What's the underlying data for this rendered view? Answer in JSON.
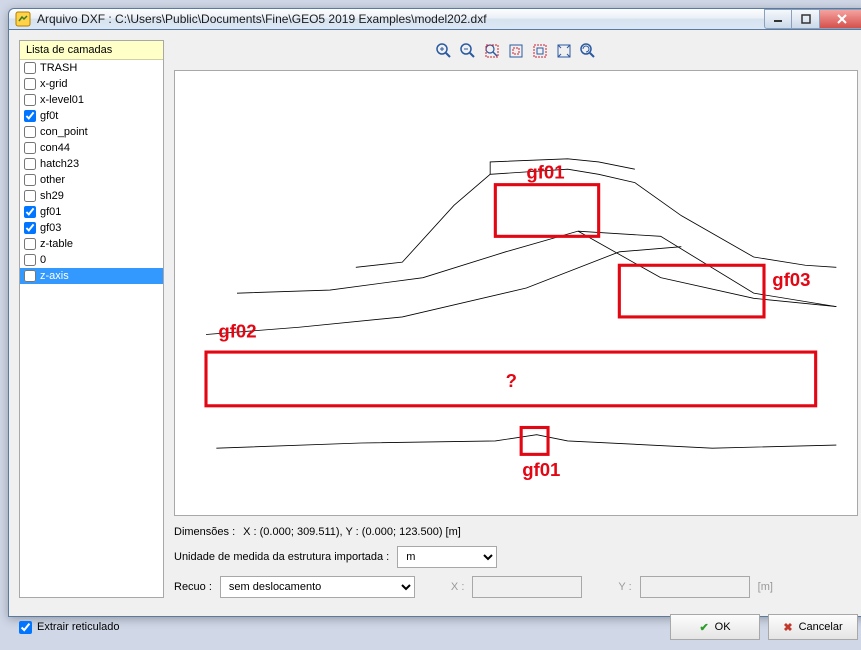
{
  "window": {
    "title": "Arquivo DXF : C:\\Users\\Public\\Documents\\Fine\\GEO5 2019 Examples\\model202.dxf"
  },
  "layers": {
    "header": "Lista de camadas",
    "items": [
      {
        "name": "TRASH",
        "checked": false,
        "selected": false
      },
      {
        "name": "x-grid",
        "checked": false,
        "selected": false
      },
      {
        "name": "x-level01",
        "checked": false,
        "selected": false
      },
      {
        "name": "gf0t",
        "checked": true,
        "selected": false
      },
      {
        "name": "con_point",
        "checked": false,
        "selected": false
      },
      {
        "name": "con44",
        "checked": false,
        "selected": false
      },
      {
        "name": "hatch23",
        "checked": false,
        "selected": false
      },
      {
        "name": "other",
        "checked": false,
        "selected": false
      },
      {
        "name": "sh29",
        "checked": false,
        "selected": false
      },
      {
        "name": "gf01",
        "checked": true,
        "selected": false
      },
      {
        "name": "gf03",
        "checked": true,
        "selected": false
      },
      {
        "name": "z-table",
        "checked": false,
        "selected": false
      },
      {
        "name": "0",
        "checked": false,
        "selected": false
      },
      {
        "name": "z-axis",
        "checked": false,
        "selected": true
      }
    ]
  },
  "toolbar": {
    "icons": [
      "zoom-in",
      "zoom-out",
      "zoom-window",
      "zoom-extents-a",
      "zoom-extents-b",
      "fit-all",
      "refresh"
    ]
  },
  "annotations": {
    "top_gf01": "gf01",
    "right_gf03": "gf03",
    "left_gf02": "gf02",
    "center_q": "?",
    "bottom_gf01": "gf01"
  },
  "dimensions": {
    "label": "Dimensões :",
    "value": "X : (0.000; 309.511), Y : (0.000; 123.500) [m]"
  },
  "unit_row": {
    "label": "Unidade de medida da estrutura importada :",
    "value": "m"
  },
  "offset_row": {
    "label": "Recuo :",
    "value": "sem deslocamento",
    "x_label": "X :",
    "x_value": "",
    "y_label": "Y :",
    "y_value": "",
    "unit": "[m]"
  },
  "footer": {
    "extract_label": "Extrair reticulado",
    "extract_checked": true,
    "ok_label": "OK",
    "cancel_label": "Cancelar"
  }
}
